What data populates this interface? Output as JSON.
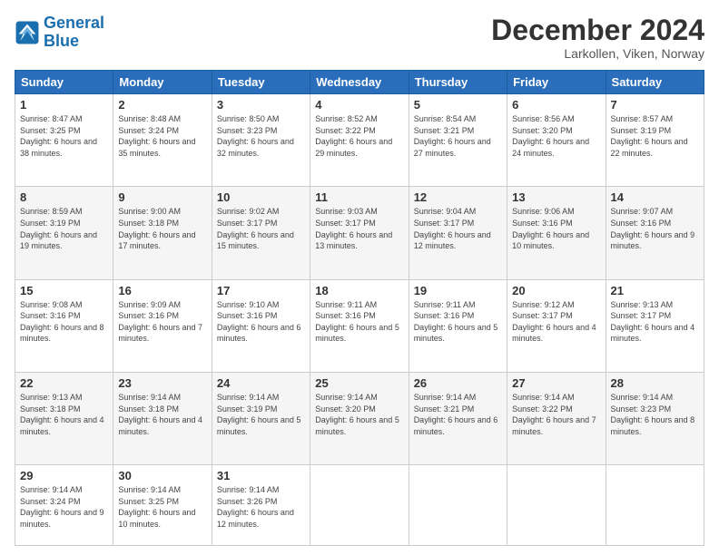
{
  "header": {
    "logo_line1": "General",
    "logo_line2": "Blue",
    "month": "December 2024",
    "location": "Larkollen, Viken, Norway"
  },
  "weekdays": [
    "Sunday",
    "Monday",
    "Tuesday",
    "Wednesday",
    "Thursday",
    "Friday",
    "Saturday"
  ],
  "weeks": [
    [
      {
        "day": "1",
        "rise": "Sunrise: 8:47 AM",
        "set": "Sunset: 3:25 PM",
        "daylight": "Daylight: 6 hours and 38 minutes."
      },
      {
        "day": "2",
        "rise": "Sunrise: 8:48 AM",
        "set": "Sunset: 3:24 PM",
        "daylight": "Daylight: 6 hours and 35 minutes."
      },
      {
        "day": "3",
        "rise": "Sunrise: 8:50 AM",
        "set": "Sunset: 3:23 PM",
        "daylight": "Daylight: 6 hours and 32 minutes."
      },
      {
        "day": "4",
        "rise": "Sunrise: 8:52 AM",
        "set": "Sunset: 3:22 PM",
        "daylight": "Daylight: 6 hours and 29 minutes."
      },
      {
        "day": "5",
        "rise": "Sunrise: 8:54 AM",
        "set": "Sunset: 3:21 PM",
        "daylight": "Daylight: 6 hours and 27 minutes."
      },
      {
        "day": "6",
        "rise": "Sunrise: 8:56 AM",
        "set": "Sunset: 3:20 PM",
        "daylight": "Daylight: 6 hours and 24 minutes."
      },
      {
        "day": "7",
        "rise": "Sunrise: 8:57 AM",
        "set": "Sunset: 3:19 PM",
        "daylight": "Daylight: 6 hours and 22 minutes."
      }
    ],
    [
      {
        "day": "8",
        "rise": "Sunrise: 8:59 AM",
        "set": "Sunset: 3:19 PM",
        "daylight": "Daylight: 6 hours and 19 minutes."
      },
      {
        "day": "9",
        "rise": "Sunrise: 9:00 AM",
        "set": "Sunset: 3:18 PM",
        "daylight": "Daylight: 6 hours and 17 minutes."
      },
      {
        "day": "10",
        "rise": "Sunrise: 9:02 AM",
        "set": "Sunset: 3:17 PM",
        "daylight": "Daylight: 6 hours and 15 minutes."
      },
      {
        "day": "11",
        "rise": "Sunrise: 9:03 AM",
        "set": "Sunset: 3:17 PM",
        "daylight": "Daylight: 6 hours and 13 minutes."
      },
      {
        "day": "12",
        "rise": "Sunrise: 9:04 AM",
        "set": "Sunset: 3:17 PM",
        "daylight": "Daylight: 6 hours and 12 minutes."
      },
      {
        "day": "13",
        "rise": "Sunrise: 9:06 AM",
        "set": "Sunset: 3:16 PM",
        "daylight": "Daylight: 6 hours and 10 minutes."
      },
      {
        "day": "14",
        "rise": "Sunrise: 9:07 AM",
        "set": "Sunset: 3:16 PM",
        "daylight": "Daylight: 6 hours and 9 minutes."
      }
    ],
    [
      {
        "day": "15",
        "rise": "Sunrise: 9:08 AM",
        "set": "Sunset: 3:16 PM",
        "daylight": "Daylight: 6 hours and 8 minutes."
      },
      {
        "day": "16",
        "rise": "Sunrise: 9:09 AM",
        "set": "Sunset: 3:16 PM",
        "daylight": "Daylight: 6 hours and 7 minutes."
      },
      {
        "day": "17",
        "rise": "Sunrise: 9:10 AM",
        "set": "Sunset: 3:16 PM",
        "daylight": "Daylight: 6 hours and 6 minutes."
      },
      {
        "day": "18",
        "rise": "Sunrise: 9:11 AM",
        "set": "Sunset: 3:16 PM",
        "daylight": "Daylight: 6 hours and 5 minutes."
      },
      {
        "day": "19",
        "rise": "Sunrise: 9:11 AM",
        "set": "Sunset: 3:16 PM",
        "daylight": "Daylight: 6 hours and 5 minutes."
      },
      {
        "day": "20",
        "rise": "Sunrise: 9:12 AM",
        "set": "Sunset: 3:17 PM",
        "daylight": "Daylight: 6 hours and 4 minutes."
      },
      {
        "day": "21",
        "rise": "Sunrise: 9:13 AM",
        "set": "Sunset: 3:17 PM",
        "daylight": "Daylight: 6 hours and 4 minutes."
      }
    ],
    [
      {
        "day": "22",
        "rise": "Sunrise: 9:13 AM",
        "set": "Sunset: 3:18 PM",
        "daylight": "Daylight: 6 hours and 4 minutes."
      },
      {
        "day": "23",
        "rise": "Sunrise: 9:14 AM",
        "set": "Sunset: 3:18 PM",
        "daylight": "Daylight: 6 hours and 4 minutes."
      },
      {
        "day": "24",
        "rise": "Sunrise: 9:14 AM",
        "set": "Sunset: 3:19 PM",
        "daylight": "Daylight: 6 hours and 5 minutes."
      },
      {
        "day": "25",
        "rise": "Sunrise: 9:14 AM",
        "set": "Sunset: 3:20 PM",
        "daylight": "Daylight: 6 hours and 5 minutes."
      },
      {
        "day": "26",
        "rise": "Sunrise: 9:14 AM",
        "set": "Sunset: 3:21 PM",
        "daylight": "Daylight: 6 hours and 6 minutes."
      },
      {
        "day": "27",
        "rise": "Sunrise: 9:14 AM",
        "set": "Sunset: 3:22 PM",
        "daylight": "Daylight: 6 hours and 7 minutes."
      },
      {
        "day": "28",
        "rise": "Sunrise: 9:14 AM",
        "set": "Sunset: 3:23 PM",
        "daylight": "Daylight: 6 hours and 8 minutes."
      }
    ],
    [
      {
        "day": "29",
        "rise": "Sunrise: 9:14 AM",
        "set": "Sunset: 3:24 PM",
        "daylight": "Daylight: 6 hours and 9 minutes."
      },
      {
        "day": "30",
        "rise": "Sunrise: 9:14 AM",
        "set": "Sunset: 3:25 PM",
        "daylight": "Daylight: 6 hours and 10 minutes."
      },
      {
        "day": "31",
        "rise": "Sunrise: 9:14 AM",
        "set": "Sunset: 3:26 PM",
        "daylight": "Daylight: 6 hours and 12 minutes."
      },
      null,
      null,
      null,
      null
    ]
  ]
}
